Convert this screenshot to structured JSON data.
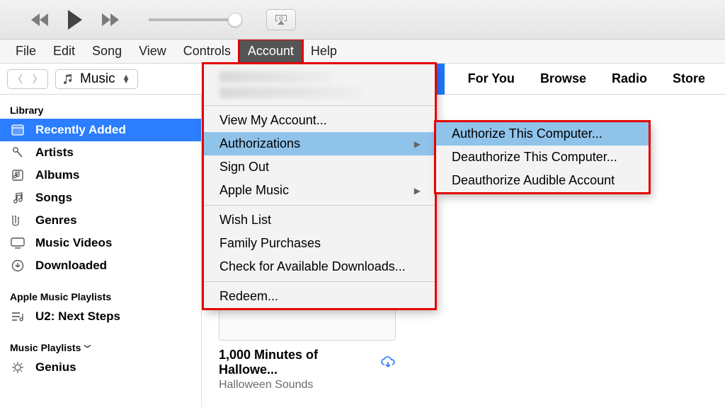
{
  "menubar": [
    "File",
    "Edit",
    "Song",
    "View",
    "Controls",
    "Account",
    "Help"
  ],
  "menubar_active_index": 5,
  "picker_label": "Music",
  "tabs": [
    "For You",
    "Browse",
    "Radio",
    "Store"
  ],
  "sidebar": {
    "library_header": "Library",
    "library_items": [
      {
        "label": "Recently Added",
        "icon": "calendar",
        "selected": true
      },
      {
        "label": "Artists",
        "icon": "mic"
      },
      {
        "label": "Albums",
        "icon": "album"
      },
      {
        "label": "Songs",
        "icon": "note"
      },
      {
        "label": "Genres",
        "icon": "guitar"
      },
      {
        "label": "Music Videos",
        "icon": "tv"
      },
      {
        "label": "Downloaded",
        "icon": "download"
      }
    ],
    "apple_playlists_header": "Apple Music Playlists",
    "apple_playlists": [
      {
        "label": "U2: Next Steps",
        "icon": "playlist"
      }
    ],
    "music_playlists_header": "Music Playlists",
    "music_playlists_collapsed": false,
    "music_playlists": [
      {
        "label": "Genius",
        "icon": "genius"
      }
    ]
  },
  "account_menu": {
    "items": [
      {
        "label": "View My Account..."
      },
      {
        "label": "Authorizations",
        "submenu": true,
        "highlight": true
      },
      {
        "label": "Sign Out"
      },
      {
        "label": "Apple Music",
        "submenu": true
      },
      "---",
      {
        "label": "Wish List"
      },
      {
        "label": "Family Purchases"
      },
      {
        "label": "Check for Available Downloads..."
      },
      "---",
      {
        "label": "Redeem..."
      }
    ]
  },
  "auth_submenu": {
    "items": [
      {
        "label": "Authorize This Computer...",
        "highlight": true
      },
      {
        "label": "Deauthorize This Computer..."
      },
      {
        "label": "Deauthorize Audible Account"
      }
    ]
  },
  "album": {
    "title": "1,000 Minutes of Hallowe...",
    "subtitle": "Halloween Sounds"
  }
}
